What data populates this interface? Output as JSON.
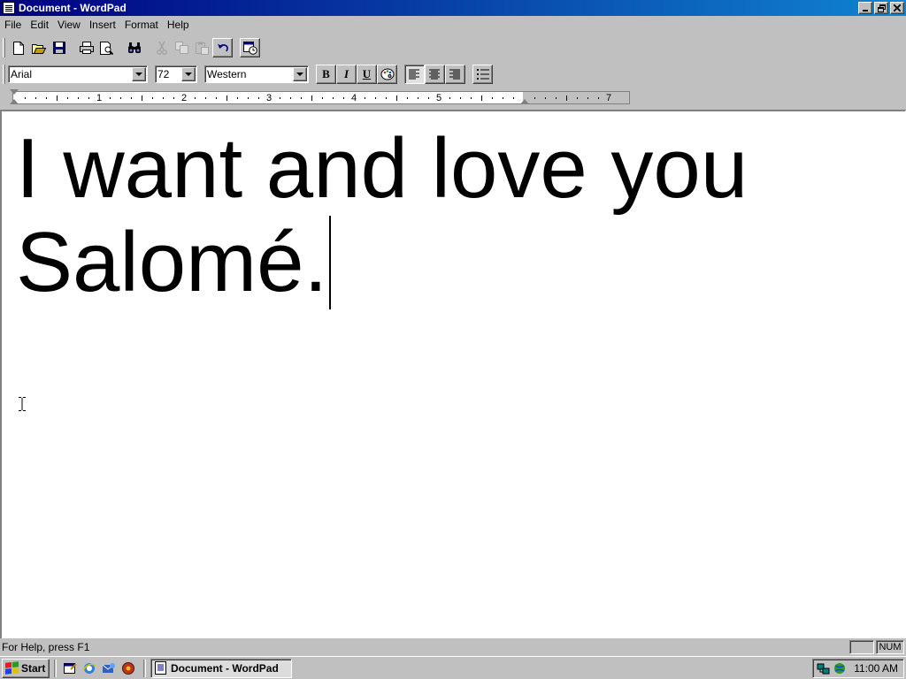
{
  "window": {
    "title": "Document - WordPad"
  },
  "menu": [
    "File",
    "Edit",
    "View",
    "Insert",
    "Format",
    "Help"
  ],
  "toolbar": {
    "buttons": [
      "new-icon",
      "open-icon",
      "save-icon",
      "print-icon",
      "print-preview-icon",
      "find-icon",
      "cut-icon",
      "copy-icon",
      "paste-icon",
      "undo-icon",
      "date-time-icon"
    ]
  },
  "format": {
    "font": "Arial",
    "size": "72",
    "script": "Western",
    "bold": "B",
    "italic": "I",
    "underline": "U"
  },
  "ruler": {
    "labels": [
      "1",
      "2",
      "3",
      "4",
      "5",
      "7"
    ]
  },
  "document": {
    "line1": "I want and love you",
    "line2": "Salomé."
  },
  "status": {
    "help": "For Help, press F1",
    "num": "NUM"
  },
  "taskbar": {
    "start": "Start",
    "task": "Document - WordPad",
    "clock": "11:00 AM"
  }
}
